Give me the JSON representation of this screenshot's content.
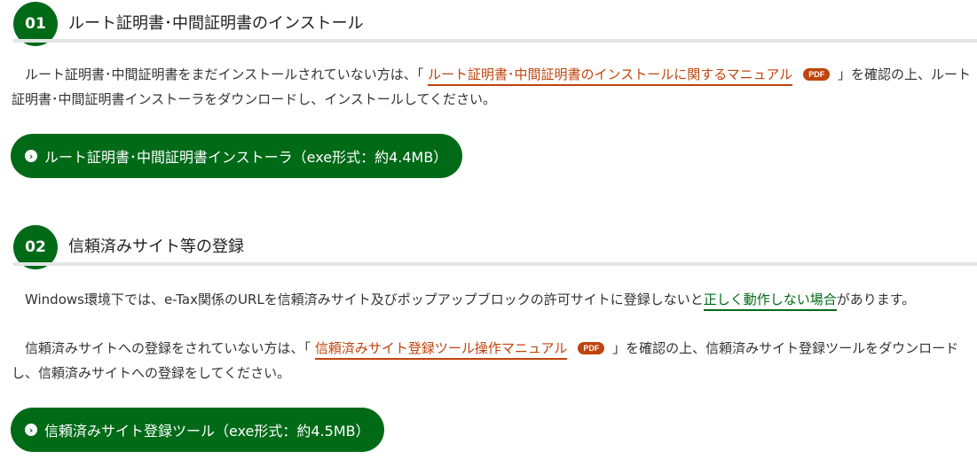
{
  "section1": {
    "number": "01",
    "title": "ルート証明書･中間証明書のインストール",
    "para_before": "　ルート証明書･中間証明書をまだインストールされていない方は、「 ",
    "link": "ルート証明書･中間証明書のインストールに関するマニュアル",
    "pdf_badge": "PDF",
    "para_after": " 」を確認の上、ルート証明書･中間証明書インストーラをダウンロードし、インストールしてください。",
    "button_label": "ルート証明書･中間証明書インストーラ（exe形式：約4.4MB）"
  },
  "section2": {
    "number": "02",
    "title": "信頼済みサイト等の登録",
    "para1_before": "　Windows環境下では、e-Tax関係のURLを信頼済みサイト及びポップアップブロックの許可サイトに登録しないと",
    "para1_link": "正しく動作しない場合",
    "para1_after": "があります。",
    "para2_before": "　信頼済みサイトへの登録をされていない方は、「 ",
    "para2_link": "信頼済みサイト登録ツール操作マニュアル",
    "pdf_badge": "PDF",
    "para2_after": " 」を確認の上、信頼済みサイト登録ツールをダウンロードし、信頼済みサイトへの登録をしてください。",
    "button_label": "信頼済みサイト登録ツール（exe形式：約4.5MB）"
  },
  "icons": {
    "button_icon": "chevron-right-circle-icon"
  },
  "colors": {
    "brand_green": "#006a17",
    "link_orange": "#c0440d",
    "divider": "#e1e6e3"
  }
}
